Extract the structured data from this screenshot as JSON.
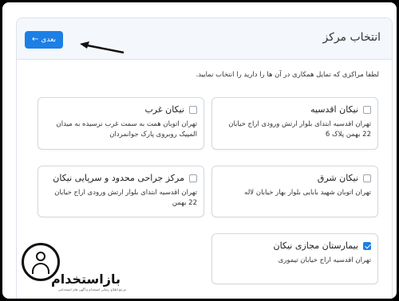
{
  "header": {
    "title": "انتخاب مرکز",
    "next_button": {
      "label": "بعدی",
      "icon": "arrow-left-icon"
    }
  },
  "instruction": "لطفا مراکزی که تمایل همکاری در آن ها را دارید را انتخاب نمایید.",
  "centers": [
    {
      "name": "نیکان اقدسیه",
      "address": "تهران اقدسیه ابتدای بلوار ارتش ورودی اراج خیابان 22 بهمن پلاک 6",
      "checked": false
    },
    {
      "name": "نیکان غرب",
      "address": "تهران اتوبان همت به سمت غرب نرسیده به میدان المپیک روبروی پارک جوانمردان",
      "checked": false
    },
    {
      "name": "نیکان شرق",
      "address": "تهران اتوبان شهید بابایی بلوار بهار خیابان لاله",
      "checked": false
    },
    {
      "name": "مرکز جراحی محدود و سرپایی نیکان",
      "address": "تهران اقدسیه ابتدای بلوار ارتش ورودی اراج خیابان 22 بهمن",
      "checked": false
    },
    {
      "name": "بیمارستان مجازی نیکان",
      "address": "تهران اقدسیه اراج خیابان تیموری",
      "checked": true
    }
  ],
  "watermark": {
    "brand": "بازاستخدام",
    "subtitle": "مرجع اطلاع رسانی استخدام و آگهی های استخدامی"
  },
  "colors": {
    "accent": "#1c7fe6",
    "header_bg": "#f4f7fb",
    "border": "#d3d9e0"
  }
}
